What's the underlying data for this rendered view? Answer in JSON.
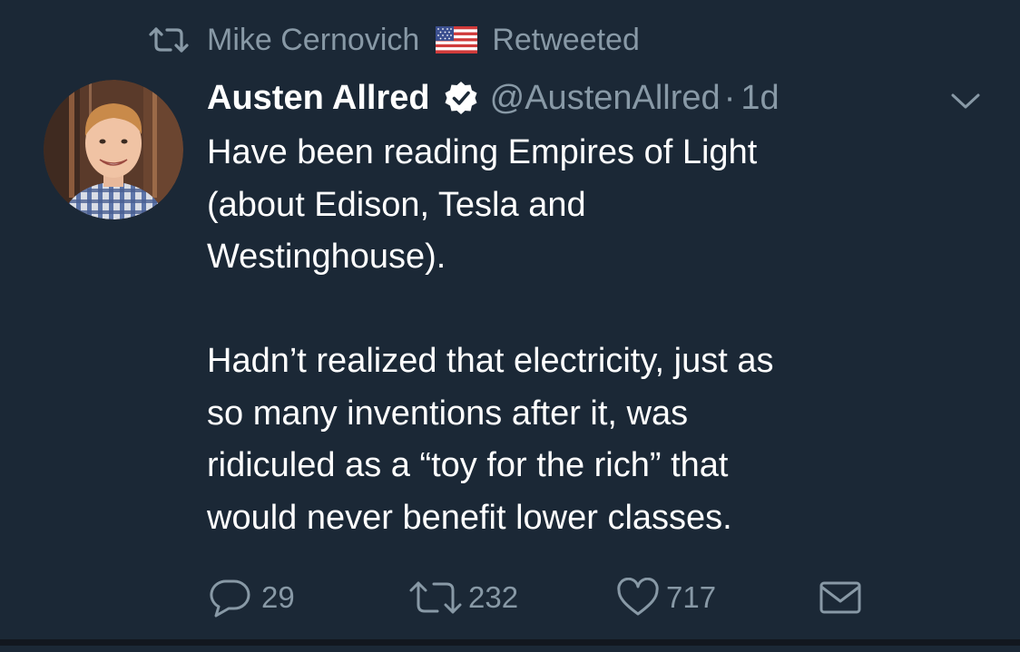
{
  "retweet_context": {
    "user": "Mike Cernovich",
    "flag": "🇺🇸",
    "label": "Retweeted"
  },
  "tweet": {
    "author_name": "Austen Allred",
    "handle": "@AustenAllred",
    "separator": "·",
    "time": "1d",
    "body_lines": [
      "Have been reading Empires of Light",
      "(about Edison, Tesla and",
      "Westinghouse).",
      "",
      "Hadn’t realized that electricity, just as",
      "so many inventions after it, was",
      "ridiculed as a “toy for the rich” that",
      "would never benefit lower classes."
    ],
    "reply_count": "29",
    "retweet_count": "232",
    "like_count": "717"
  },
  "icons": {
    "retweet": "retweet-icon",
    "verified": "verified-badge-icon",
    "menu": "chevron-down-icon",
    "reply": "reply-icon",
    "like": "heart-icon",
    "dm": "envelope-icon"
  },
  "colors": {
    "background": "#1b2836",
    "text_primary": "#ffffff",
    "text_secondary": "#8899a6"
  }
}
